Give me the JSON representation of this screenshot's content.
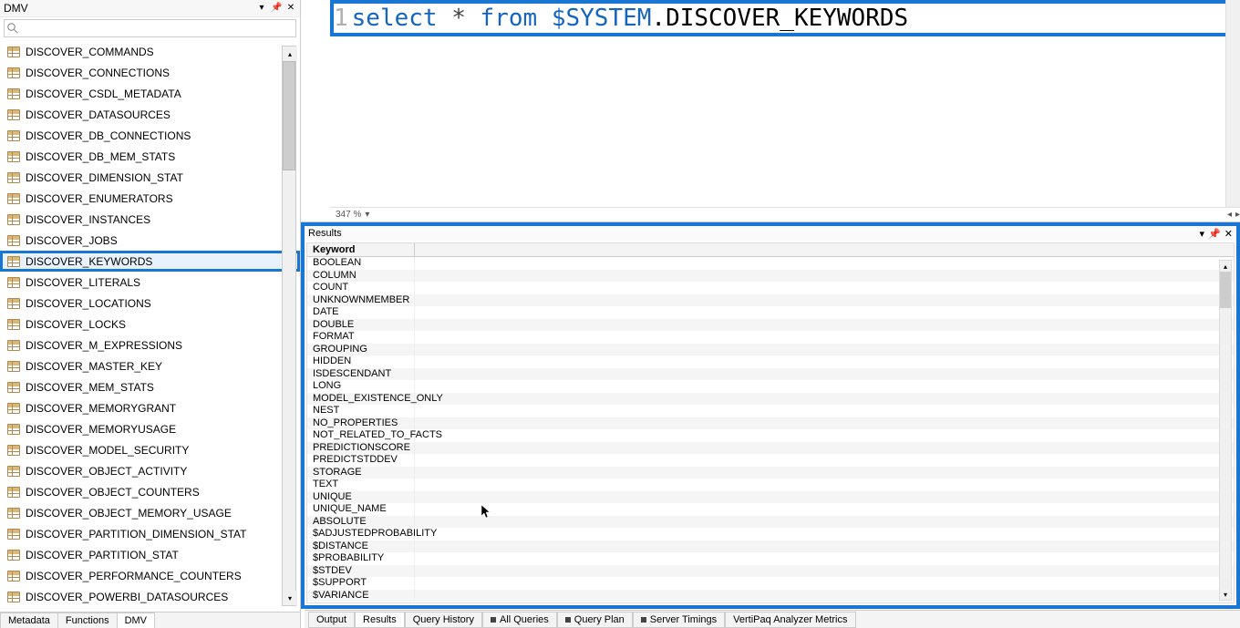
{
  "leftPanel": {
    "title": "DMV",
    "searchPlaceholder": "",
    "items": [
      "DISCOVER_COMMANDS",
      "DISCOVER_CONNECTIONS",
      "DISCOVER_CSDL_METADATA",
      "DISCOVER_DATASOURCES",
      "DISCOVER_DB_CONNECTIONS",
      "DISCOVER_DB_MEM_STATS",
      "DISCOVER_DIMENSION_STAT",
      "DISCOVER_ENUMERATORS",
      "DISCOVER_INSTANCES",
      "DISCOVER_JOBS",
      "DISCOVER_KEYWORDS",
      "DISCOVER_LITERALS",
      "DISCOVER_LOCATIONS",
      "DISCOVER_LOCKS",
      "DISCOVER_M_EXPRESSIONS",
      "DISCOVER_MASTER_KEY",
      "DISCOVER_MEM_STATS",
      "DISCOVER_MEMORYGRANT",
      "DISCOVER_MEMORYUSAGE",
      "DISCOVER_MODEL_SECURITY",
      "DISCOVER_OBJECT_ACTIVITY",
      "DISCOVER_OBJECT_COUNTERS",
      "DISCOVER_OBJECT_MEMORY_USAGE",
      "DISCOVER_PARTITION_DIMENSION_STAT",
      "DISCOVER_PARTITION_STAT",
      "DISCOVER_PERFORMANCE_COUNTERS",
      "DISCOVER_POWERBI_DATASOURCES"
    ],
    "selectedIndex": 10,
    "tabs": [
      "Metadata",
      "Functions",
      "DMV"
    ],
    "activeTabIndex": 2
  },
  "editor": {
    "lineNumber": "1",
    "tokens": {
      "select": "select",
      "star": "*",
      "from": "from",
      "sys": "$SYSTEM",
      "dot": ".",
      "table": "DISCOVER_KEYWORDS"
    },
    "zoom": "347 %"
  },
  "results": {
    "title": "Results",
    "headerCol": "Keyword",
    "rows": [
      "BOOLEAN",
      "COLUMN",
      "COUNT",
      "UNKNOWNMEMBER",
      "DATE",
      "DOUBLE",
      "FORMAT",
      "GROUPING",
      "HIDDEN",
      "ISDESCENDANT",
      "LONG",
      "MODEL_EXISTENCE_ONLY",
      "NEST",
      "NO_PROPERTIES",
      "NOT_RELATED_TO_FACTS",
      "PREDICTIONSCORE",
      "PREDICTSTDDEV",
      "STORAGE",
      "TEXT",
      "UNIQUE",
      "UNIQUE_NAME",
      "ABSOLUTE",
      "$ADJUSTEDPROBABILITY",
      "$DISTANCE",
      "$PROBABILITY",
      "$STDEV",
      "$SUPPORT",
      "$VARIANCE"
    ]
  },
  "outputTabs": [
    {
      "label": "Output",
      "hasStop": false
    },
    {
      "label": "Results",
      "hasStop": false,
      "active": true
    },
    {
      "label": "Query History",
      "hasStop": false
    },
    {
      "label": "All Queries",
      "hasStop": true
    },
    {
      "label": "Query Plan",
      "hasStop": true
    },
    {
      "label": "Server Timings",
      "hasStop": true
    },
    {
      "label": "VertiPaq Analyzer Metrics",
      "hasStop": false
    }
  ]
}
